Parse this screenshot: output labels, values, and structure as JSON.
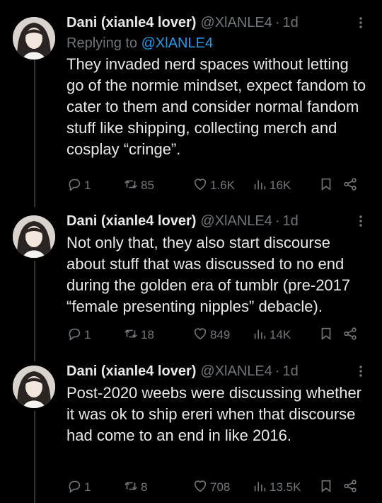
{
  "colors": {
    "background": "#000000",
    "text": "#e7e9ea",
    "muted": "#71767b",
    "link": "#1d9bf0"
  },
  "tweets": [
    {
      "author": "Dani (xianle4 lover)",
      "handle": "@XlANLE4",
      "separator": "·",
      "time": "1d",
      "reply_prefix": "Replying to ",
      "reply_to": "@XlANLE4",
      "text": "They invaded nerd spaces without letting go of the normie mindset, expect fandom to cater to them and consider normal fandom stuff like shipping, collecting merch and cosplay “cringe”.",
      "stats": {
        "replies": "1",
        "retweets": "85",
        "likes": "1.6K",
        "views": "16K"
      }
    },
    {
      "author": "Dani (xianle4 lover)",
      "handle": "@XlANLE4",
      "separator": "·",
      "time": "1d",
      "text": "Not only that, they also start discourse about stuff that was discussed to no end during the golden era of tumblr (pre-2017 “female presenting nipples” debacle).",
      "stats": {
        "replies": "1",
        "retweets": "18",
        "likes": "849",
        "views": "14K"
      }
    },
    {
      "author": "Dani (xianle4 lover)",
      "handle": "@XlANLE4",
      "separator": "·",
      "time": "1d",
      "text": "Post-2020 weebs were discussing whether it was ok to ship ereri when that discourse had come to an end in like 2016.",
      "stats": {
        "replies": "1",
        "retweets": "8",
        "likes": "708",
        "views": "13.5K"
      }
    }
  ],
  "icons": [
    "avatar",
    "more-icon",
    "reply-icon",
    "retweet-icon",
    "like-icon",
    "views-icon",
    "bookmark-icon",
    "share-icon"
  ]
}
